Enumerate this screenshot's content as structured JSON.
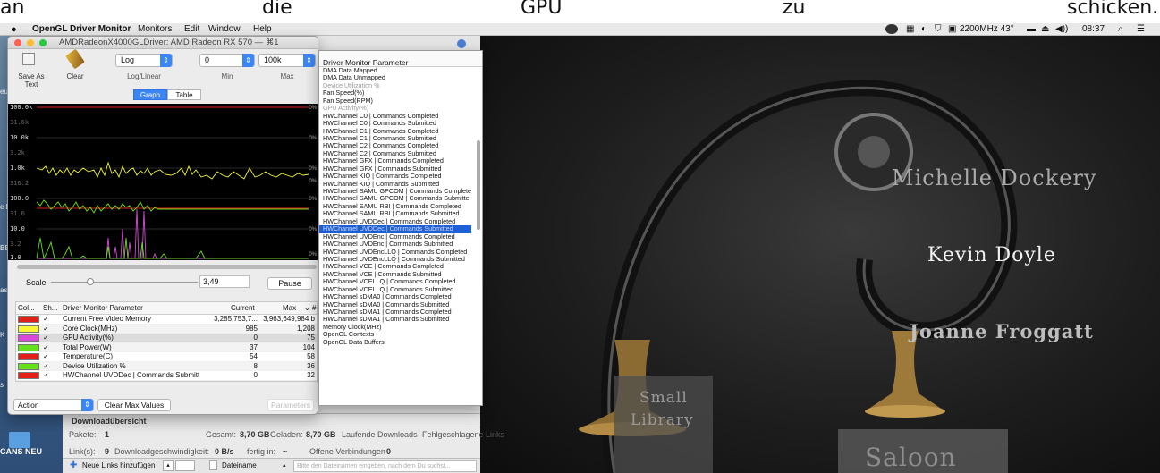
{
  "caption": {
    "words": [
      "an",
      "die",
      "GPU",
      "zu",
      "schicken."
    ]
  },
  "menubar": {
    "apple": "",
    "app": "OpenGL Driver Monitor",
    "items": [
      "Monitors",
      "Edit",
      "Window",
      "Help"
    ],
    "cpu": "2200MHz 43°",
    "time": "08:37"
  },
  "window": {
    "title": "AMDRadeonX4000GLDriver: AMD Radeon RX 570 — ⌘1",
    "toolbar": {
      "save_label": "Save As Text",
      "clear_label": "Clear",
      "scale_mode": "Log",
      "scale_mode_label": "Log/Linear",
      "min_value": "0",
      "min_label": "Min",
      "max_value": "100k",
      "max_label": "Max"
    },
    "tabs": [
      "Graph",
      "Table"
    ],
    "graph": {
      "ticks": [
        "100.0k",
        "31.6k",
        "10.0k",
        "3.2k",
        "1.0k",
        "316.2",
        "100.0",
        "31.6",
        "10.0",
        "3.2",
        "1.0"
      ],
      "pct": [
        "0%",
        "0%",
        "0%",
        "0%",
        "0%",
        "0%",
        "0%"
      ]
    },
    "scale": {
      "label": "Scale",
      "value": "3,49",
      "pause_label": "Pause"
    },
    "table": {
      "headers": {
        "color": "Col...",
        "show": "Sh...",
        "name": "Driver Monitor Parameter",
        "current": "Current",
        "max": "Max",
        "sort": "⌄",
        "hash": "#"
      },
      "rows": [
        {
          "color": "#e0201b",
          "check": "✓",
          "name": "Current Free Video Memory",
          "current": "3,285,753,7...",
          "max": "3,963,649,984 b"
        },
        {
          "color": "#f5f53a",
          "check": "✓",
          "name": "Core Clock(MHz)",
          "current": "985",
          "max": "1,208"
        },
        {
          "color": "#d94ad8",
          "check": "✓",
          "name": "GPU Activity(%)",
          "current": "0",
          "max": "75"
        },
        {
          "color": "#67e01e",
          "check": "✓",
          "name": "Total Power(W)",
          "current": "37",
          "max": "104"
        },
        {
          "color": "#e0201b",
          "check": "✓",
          "name": "Temperature(C)",
          "current": "54",
          "max": "58"
        },
        {
          "color": "#67e01e",
          "check": "✓",
          "name": "Device Utilization %",
          "current": "8",
          "max": "36"
        },
        {
          "color": "#e0201b",
          "check": "✓",
          "name": "HWChannel UVDDec | Commands Submitt",
          "current": "0",
          "max": "32"
        }
      ]
    },
    "bottom": {
      "action_label": "Action",
      "clear_max_label": "Clear Max Values",
      "parameters_label": "Parameters"
    }
  },
  "param_list": {
    "header": "Driver Monitor Parameter",
    "items": [
      {
        "label": "DMA Data Mapped",
        "state": ""
      },
      {
        "label": "DMA Data Unmapped",
        "state": ""
      },
      {
        "label": "Device Utilization %",
        "state": "dis"
      },
      {
        "label": "Fan Speed(%)",
        "state": ""
      },
      {
        "label": "Fan Speed(RPM)",
        "state": ""
      },
      {
        "label": "GPU Activity(%)",
        "state": "dis"
      },
      {
        "label": "HWChannel C0 | Commands Completed",
        "state": ""
      },
      {
        "label": "HWChannel C0 | Commands Submitted",
        "state": ""
      },
      {
        "label": "HWChannel C1 | Commands Completed",
        "state": ""
      },
      {
        "label": "HWChannel C1 | Commands Submitted",
        "state": ""
      },
      {
        "label": "HWChannel C2 | Commands Completed",
        "state": ""
      },
      {
        "label": "HWChannel C2 | Commands Submitted",
        "state": ""
      },
      {
        "label": "HWChannel GFX | Commands Completed",
        "state": ""
      },
      {
        "label": "HWChannel GFX | Commands Submitted",
        "state": ""
      },
      {
        "label": "HWChannel KIQ | Commands Completed",
        "state": ""
      },
      {
        "label": "HWChannel KIQ | Commands Submitted",
        "state": ""
      },
      {
        "label": "HWChannel SAMU GPCOM | Commands Complete",
        "state": ""
      },
      {
        "label": "HWChannel SAMU GPCOM | Commands Submitte",
        "state": ""
      },
      {
        "label": "HWChannel SAMU RBI | Commands Completed",
        "state": ""
      },
      {
        "label": "HWChannel SAMU RBI | Commands Submitted",
        "state": ""
      },
      {
        "label": "HWChannel UVDDec | Commands Completed",
        "state": ""
      },
      {
        "label": "HWChannel UVDDec | Commands Submitted",
        "state": "sel"
      },
      {
        "label": "HWChannel UVDEnc | Commands Completed",
        "state": ""
      },
      {
        "label": "HWChannel UVDEnc | Commands Submitted",
        "state": ""
      },
      {
        "label": "HWChannel UVDEncLLQ | Commands Completed",
        "state": ""
      },
      {
        "label": "HWChannel UVDEncLLQ | Commands Submitted",
        "state": ""
      },
      {
        "label": "HWChannel VCE | Commands Completed",
        "state": ""
      },
      {
        "label": "HWChannel VCE | Commands Submitted",
        "state": ""
      },
      {
        "label": "HWChannel VCELLQ | Commands Completed",
        "state": ""
      },
      {
        "label": "HWChannel VCELLQ | Commands Submitted",
        "state": ""
      },
      {
        "label": "HWChannel sDMA0 | Commands Completed",
        "state": ""
      },
      {
        "label": "HWChannel sDMA0 | Commands Submitted",
        "state": ""
      },
      {
        "label": "HWChannel sDMA1 | Commands Completed",
        "state": ""
      },
      {
        "label": "HWChannel sDMA1 | Commands Submitted",
        "state": ""
      },
      {
        "label": "Memory Clock(MHz)",
        "state": ""
      },
      {
        "label": "OpenGL Contexts",
        "state": ""
      },
      {
        "label": "OpenGL Data Buffers",
        "state": ""
      }
    ]
  },
  "downloads": {
    "title": "Downloadübersicht",
    "pakete_label": "Pakete:",
    "pakete": "1",
    "gesamt_label": "Gesamt:",
    "gesamt": "8,70 GB",
    "geladen_label": "Geladen:",
    "geladen": "8,70 GB",
    "laufende": "Laufende Downloads",
    "fehlgeschlagen": "Fehlgeschlagene Links",
    "links_label": "Link(s):",
    "links": "9",
    "speed_label": "Downloadgeschwindigkeit:",
    "speed": "0 B/s",
    "fertig_label": "fertig in:",
    "fertig": "~",
    "offene": "Offene Verbindungen",
    "offene_count": "0",
    "add_links_label": "Neue Links hinzufügen",
    "filename_label": "Dateiname",
    "filename_placeholder": "Bitte den Dateinamen eingeben, nach dem Du suchst..."
  },
  "desktop": {
    "side_labels": [
      "eu",
      "e R",
      "BE",
      "ast",
      "K",
      "s"
    ],
    "bottom_label": "CANS NEU"
  },
  "video": {
    "credits": [
      "Michelle Dockery",
      "Kevin Doyle",
      "Joanne Froggatt"
    ],
    "signs": [
      "Small",
      "Library",
      "Saloon"
    ]
  }
}
